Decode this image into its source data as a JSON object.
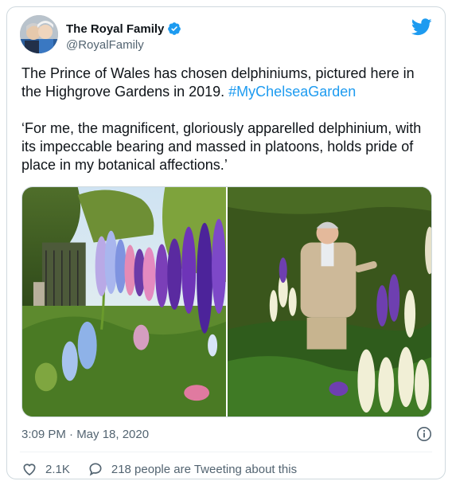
{
  "author": {
    "name": "The Royal Family",
    "handle": "@RoyalFamily"
  },
  "tweet": {
    "paragraph1_text": "The Prince of Wales has chosen delphiniums, pictured here in the Highgrove Gardens in 2019. ",
    "hashtag": "#MyChelseaGarden",
    "paragraph2": "‘For me, the magnificent, gloriously apparelled delphinium, with its impeccable bearing and massed in platoons, holds pride of place in my botanical affections.’"
  },
  "timestamp": "3:09 PM · May 18, 2020",
  "actions": {
    "likes": "2.1K",
    "conversation": "218 people are Tweeting about this"
  },
  "colors": {
    "accent": "#1d9bf0",
    "secondary_text": "#536471",
    "border": "#cfd9de"
  },
  "icons": [
    "verified-badge-icon",
    "twitter-bird-icon",
    "info-icon",
    "heart-icon",
    "speech-bubble-icon"
  ]
}
